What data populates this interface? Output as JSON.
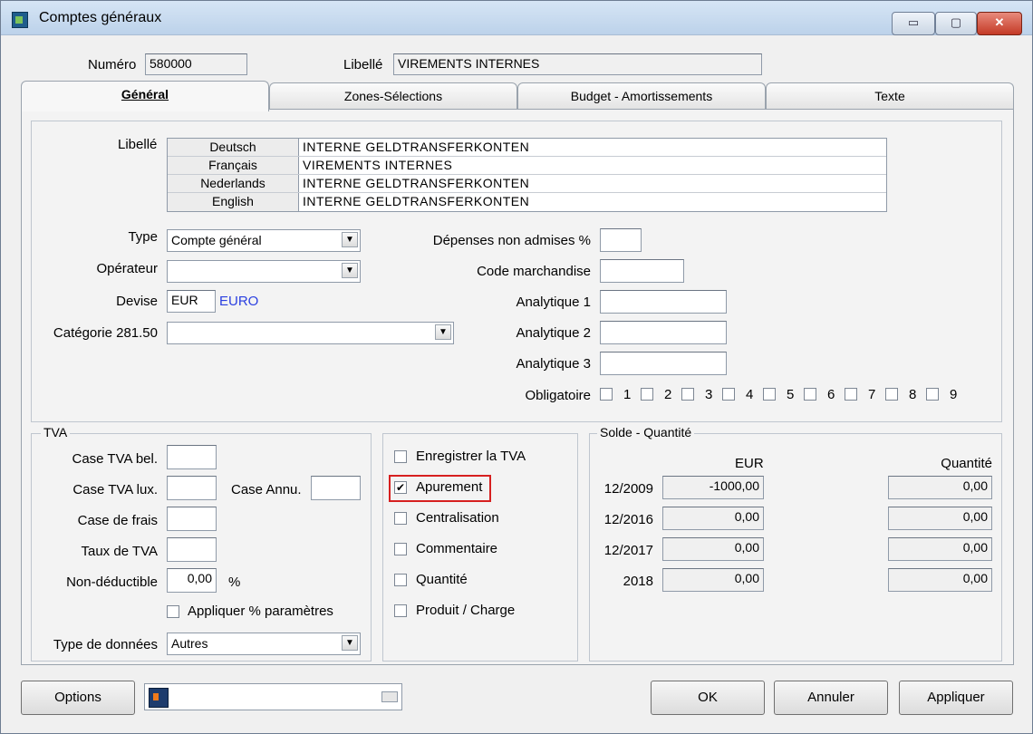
{
  "window": {
    "title": "Comptes généraux",
    "controls": {
      "minimize": "▭",
      "maximize": "▢",
      "close": "✕"
    }
  },
  "header": {
    "numero_label": "Numéro",
    "numero_value": "580000",
    "libelle_label": "Libellé",
    "libelle_value": "VIREMENTS INTERNES"
  },
  "tabs": [
    {
      "label": "Général"
    },
    {
      "label": "Zones-Sélections"
    },
    {
      "label": "Budget - Amortissements"
    },
    {
      "label": "Texte"
    }
  ],
  "general": {
    "libelle_label": "Libellé",
    "translations": [
      {
        "lang": "Deutsch",
        "value": "INTERNE GELDTRANSFERKONTEN"
      },
      {
        "lang": "Français",
        "value": "VIREMENTS INTERNES"
      },
      {
        "lang": "Nederlands",
        "value": "INTERNE GELDTRANSFERKONTEN"
      },
      {
        "lang": "English",
        "value": "INTERNE GELDTRANSFERKONTEN"
      }
    ],
    "type_label": "Type",
    "type_value": "Compte général",
    "operateur_label": "Opérateur",
    "operateur_value": "",
    "devise_label": "Devise",
    "devise_code": "EUR",
    "devise_name": "EURO",
    "categorie_label": "Catégorie 281.50",
    "categorie_value": "",
    "depenses_label": "Dépenses non admises %",
    "code_marchandise_label": "Code marchandise",
    "analytique1_label": "Analytique 1",
    "analytique2_label": "Analytique 2",
    "analytique3_label": "Analytique 3",
    "obligatoire_label": "Obligatoire",
    "obligatoire_items": [
      "1",
      "2",
      "3",
      "4",
      "5",
      "6",
      "7",
      "8",
      "9"
    ]
  },
  "tva": {
    "title": "TVA",
    "case_bel_label": "Case TVA bel.",
    "case_lux_label": "Case TVA lux.",
    "case_annu_label": "Case Annu.",
    "case_frais_label": "Case de frais",
    "taux_label": "Taux de TVA",
    "non_deductible_label": "Non-déductible",
    "non_deductible_value": "0,00",
    "percent": "%",
    "appliquer_label": "Appliquer % paramètres",
    "type_donnees_label": "Type de données",
    "type_donnees_value": "Autres"
  },
  "options_checks": [
    {
      "label": "Enregistrer la TVA",
      "checked": false
    },
    {
      "label": "Apurement",
      "checked": true
    },
    {
      "label": "Centralisation",
      "checked": false
    },
    {
      "label": "Commentaire",
      "checked": false
    },
    {
      "label": "Quantité",
      "checked": false
    },
    {
      "label": "Produit / Charge",
      "checked": false
    }
  ],
  "solde": {
    "title": "Solde - Quantité",
    "eur_header": "EUR",
    "qty_header": "Quantité",
    "rows": [
      {
        "period": "12/2009",
        "eur": "-1000,00",
        "qty": "0,00"
      },
      {
        "period": "12/2016",
        "eur": "0,00",
        "qty": "0,00"
      },
      {
        "period": "12/2017",
        "eur": "0,00",
        "qty": "0,00"
      },
      {
        "period": "2018",
        "eur": "0,00",
        "qty": "0,00"
      }
    ]
  },
  "footer": {
    "options": "Options",
    "ok": "OK",
    "annuler": "Annuler",
    "appliquer": "Appliquer"
  },
  "check_mark": "✔",
  "dropdown_arrow": "▼"
}
